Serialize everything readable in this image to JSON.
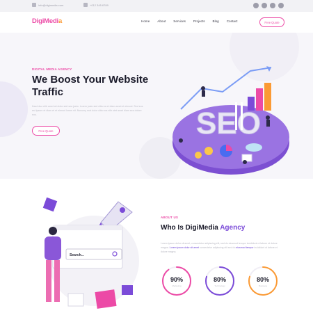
{
  "topbar": {
    "email": "info@digimedia.com",
    "phone": "+012 345 6789",
    "socials": [
      {
        "icon": "facebook-icon"
      },
      {
        "icon": "twitter-icon"
      },
      {
        "icon": "linkedin-icon"
      },
      {
        "icon": "instagram-icon"
      }
    ]
  },
  "header": {
    "logo_main": "DigiMedi",
    "logo_accent": "a",
    "nav": [
      "Home",
      "About",
      "Services",
      "Projects",
      "Blog",
      "Contact"
    ],
    "cta": "Free Quote"
  },
  "hero": {
    "eyebrow": "DIGITAL MEDIA AGENCY",
    "title": "We Boost Your Website Traffic",
    "text": "Kasd duo elitr amet sit dolor stet sea justo. Lorem justo stet clita ea et diam amet et eirmod. Sed eos est ipsum et diam et et eirmod lorem sit. Nonumy erat dolor clita eos elitr stet amet diam sea dolore eos.",
    "cta": "Free Quote",
    "illustration_label": "SEO"
  },
  "about": {
    "eyebrow": "ABOUT US",
    "title_main": "Who Is DigiMedia ",
    "title_accent": "Agency",
    "text_1": "Lorem ipsum dolor sit amet, consectetur adipiscing elit, sed do eiusmod tempor incididunt ut labore et dolore magna. ",
    "link_1": "Lorem ipsum dolor sit amet",
    "text_2": " consectetur adipiscing elit sed do ",
    "link_2": "eiusmod tempor",
    "text_3": " incididunt ut labore et dolore magna.",
    "search_placeholder": "Search...",
    "stats": [
      {
        "value": "90%",
        "label": "Marketing",
        "fraction": 0.9,
        "color": "#ec4aa6"
      },
      {
        "value": "80%",
        "label": "Technology",
        "fraction": 0.8,
        "color": "#7b4bd8"
      },
      {
        "value": "80%",
        "label": "Business",
        "fraction": 0.8,
        "color": "#fb9a34"
      }
    ]
  },
  "colors": {
    "pink": "#ec4aa6",
    "purple": "#7b4bd8",
    "orange": "#fb9a34"
  }
}
